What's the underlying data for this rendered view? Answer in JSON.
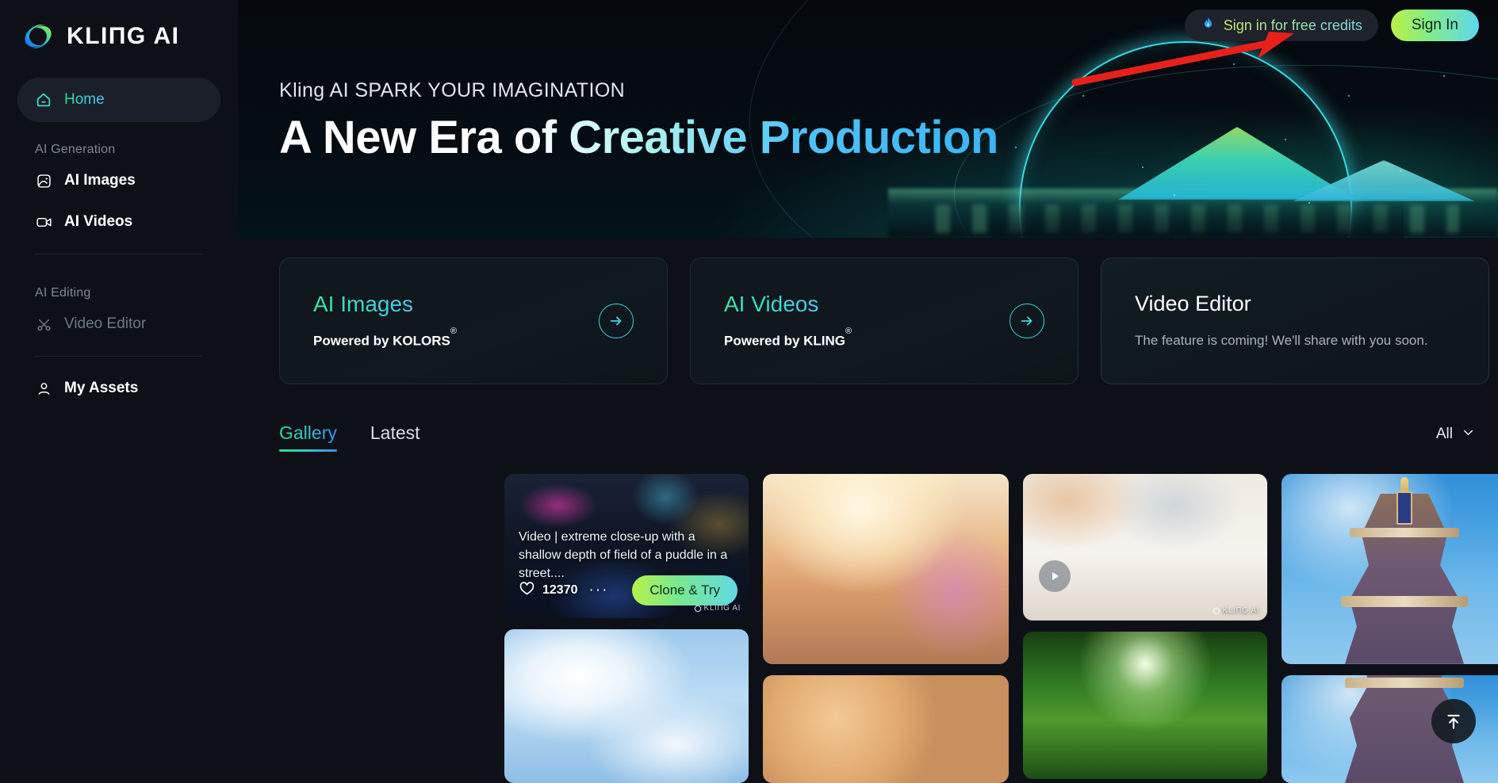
{
  "brand": {
    "name": "KLIПG AI",
    "logo_icon": "kling-swirl-logo"
  },
  "header": {
    "credits_label": "Sign in for free credits",
    "credits_icon": "flame-icon",
    "signin_label": "Sign In",
    "annotation_icon": "red-arrow-annotation"
  },
  "sidebar": {
    "home": {
      "label": "Home",
      "icon": "home-icon"
    },
    "sections": [
      {
        "title": "AI Generation",
        "items": [
          {
            "label": "AI Images",
            "icon": "image-icon",
            "disabled": false
          },
          {
            "label": "AI Videos",
            "icon": "video-camera-icon",
            "disabled": false
          }
        ]
      },
      {
        "title": "AI Editing",
        "items": [
          {
            "label": "Video Editor",
            "icon": "scissors-icon",
            "disabled": true
          }
        ]
      }
    ],
    "assets": {
      "label": "My Assets",
      "icon": "user-icon"
    }
  },
  "hero": {
    "kicker": "Kling AI SPARK YOUR IMAGINATION",
    "title": "A New Era of Creative Production"
  },
  "cards": [
    {
      "title": "AI Images",
      "subtitle": "Powered by KOLORS",
      "sup": "®",
      "arrow_icon": "arrow-right-icon",
      "style": "feature"
    },
    {
      "title": "AI Videos",
      "subtitle": "Powered by KLING",
      "sup": "®",
      "arrow_icon": "arrow-right-icon",
      "style": "feature"
    },
    {
      "title": "Video Editor",
      "subtitle": "The feature is coming! We'll share with you soon.",
      "sup": "",
      "arrow_icon": "",
      "style": "ghost"
    }
  ],
  "gallery": {
    "tabs": [
      {
        "label": "Gallery",
        "active": true
      },
      {
        "label": "Latest",
        "active": false
      }
    ],
    "filter": {
      "label": "All",
      "icon": "chevron-down-icon"
    },
    "first_card": {
      "caption": "Video | extreme close-up with a shallow depth of field of a puddle in a street....",
      "likes": "12370",
      "like_icon": "heart-icon",
      "more_icon": "ellipsis-icon",
      "clone_label": "Clone & Try",
      "watermark": "KLIПG AI"
    },
    "watermark": "KLIПG AI",
    "play_icon": "play-icon"
  },
  "scroll_top": {
    "icon": "scroll-to-top-icon"
  },
  "colors": {
    "page_bg": "#0d1117",
    "sidebar_bg": "#0d1117",
    "accent_green": "#2fe08a",
    "accent_cyan": "#3ad9c8",
    "accent_blue": "#49c6f5",
    "annotation_red": "#e8201a"
  }
}
